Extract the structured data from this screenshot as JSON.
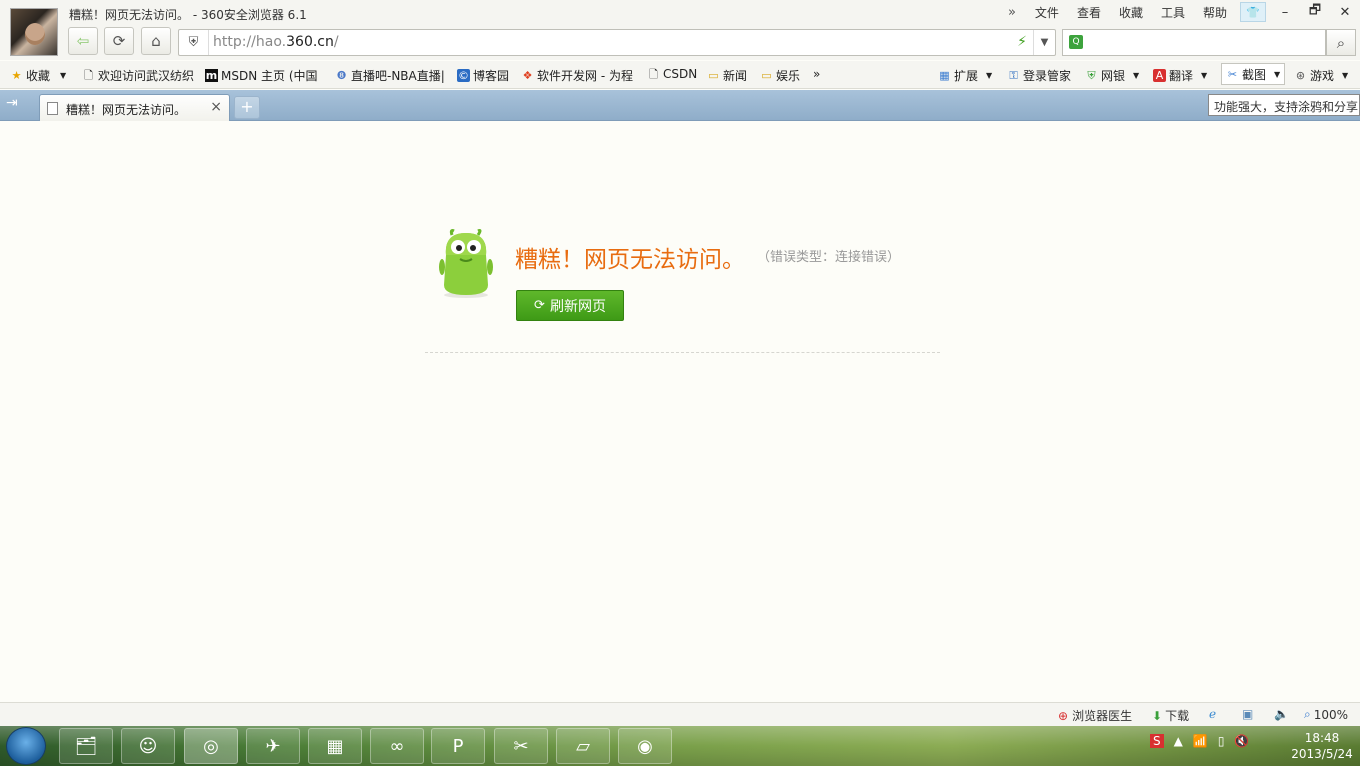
{
  "window": {
    "title": "糟糕！网页无法访问。 - 360安全浏览器 6.1",
    "more": "»",
    "menu": [
      "文件",
      "查看",
      "收藏",
      "工具",
      "帮助"
    ],
    "controls": [
      "–",
      "🗗",
      "✕"
    ]
  },
  "address": {
    "url_prefix": "http://hao.",
    "url_domain": "360.cn",
    "url_suffix": "/",
    "search_placeholder": ""
  },
  "bookmarks": {
    "items": [
      {
        "label": "收藏",
        "icon": "star-icon"
      },
      {
        "label": "欢迎访问武汉纺织",
        "icon": "page-icon"
      },
      {
        "label": "MSDN 主页 (中国",
        "icon": "msdn-icon"
      },
      {
        "label": "直播吧-NBA直播|",
        "icon": "zhibo8-icon"
      },
      {
        "label": "博客园",
        "icon": "cnblogs-icon"
      },
      {
        "label": "软件开发网 - 为程",
        "icon": "windows-icon"
      },
      {
        "label": "CSDN",
        "icon": "page-icon"
      },
      {
        "label": "新闻",
        "icon": "folder-icon"
      },
      {
        "label": "娱乐",
        "icon": "folder-icon"
      }
    ],
    "overflow": "»",
    "right_items": [
      {
        "label": "扩展",
        "icon": "extensions-icon"
      },
      {
        "label": "登录管家",
        "icon": "key-icon"
      },
      {
        "label": "网银",
        "icon": "shield-icon"
      },
      {
        "label": "翻译",
        "icon": "translate-icon"
      },
      {
        "label": "截图",
        "icon": "screenshot-icon"
      },
      {
        "label": "游戏",
        "icon": "gamepad-icon"
      }
    ]
  },
  "tabs": {
    "active_title": "糟糕！网页无法访问。",
    "new_tab": "+",
    "close": "×"
  },
  "tooltip": "功能强大，支持涂鸦和分享",
  "error": {
    "title": "糟糕！网页无法访问。",
    "type": "（错误类型：连接错误）",
    "refresh_label": "刷新网页"
  },
  "statusbar": {
    "doctor": "浏览器医生",
    "download": "下载",
    "zoom": "100%"
  },
  "clock": {
    "time": "18:48",
    "date": "2013/5/24"
  },
  "colors": {
    "error_orange": "#e86c10",
    "button_green": "#4aa81e",
    "tabbar_blue": "#9db8d2"
  }
}
